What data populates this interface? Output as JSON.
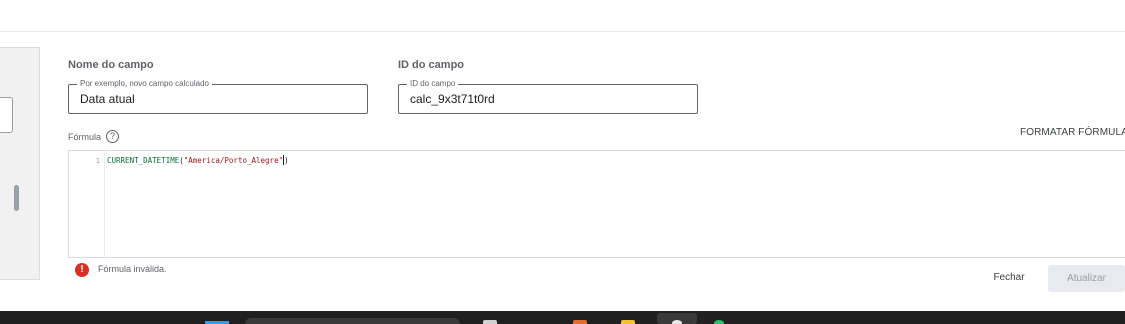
{
  "field_name": {
    "heading": "Nome do campo",
    "legend": "Por exemplo, novo campo calculado",
    "value": "Data atual"
  },
  "field_id": {
    "heading": "ID do campo",
    "legend": "ID do campo",
    "value": "calc_9x3t71t0rd"
  },
  "formula": {
    "label": "Fórmula",
    "help_glyph": "?",
    "format_link": "FORMATAR FÓRMULA",
    "line_number": "1",
    "code": {
      "function_name": "CURRENT_DATETIME",
      "open_paren": "(",
      "string_literal": "\"America/Porto_Alegre\"",
      "close_paren": ")"
    }
  },
  "error": {
    "icon_glyph": "!",
    "message": "Fórmula inválida."
  },
  "actions": {
    "close_label": "Fechar",
    "update_label": "Atualizar"
  },
  "icons": {
    "help": "help-circle-icon",
    "error": "error-circle-icon"
  },
  "colors": {
    "error": "#d93025",
    "function_token": "#0b6e3a",
    "string_token": "#a31515",
    "disabled_button_bg": "#e8eaed",
    "disabled_button_text": "#9aa0a6"
  }
}
